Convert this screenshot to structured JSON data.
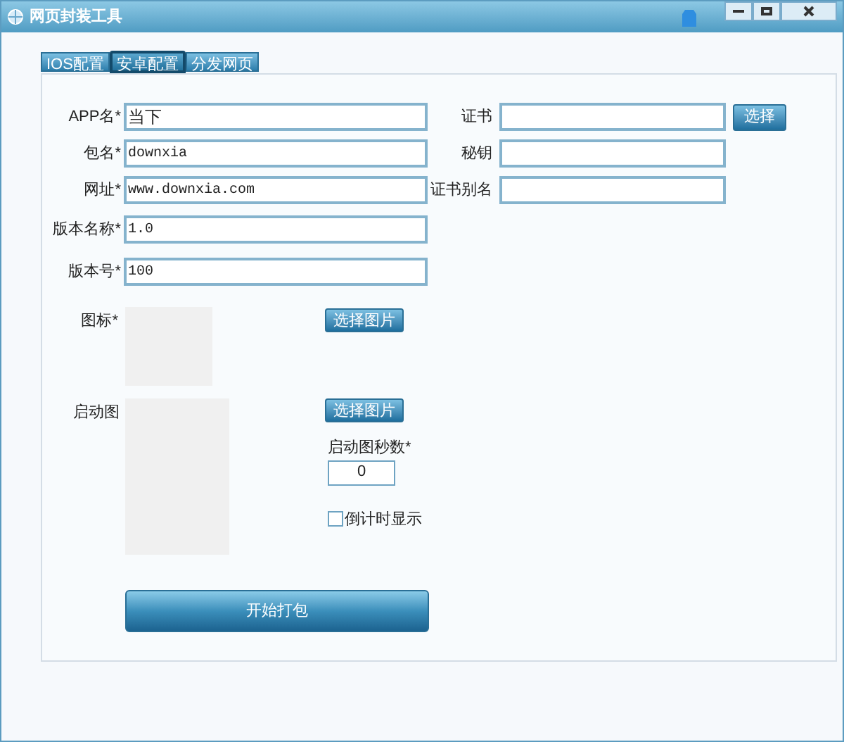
{
  "window": {
    "title": "网页封装工具"
  },
  "tabs": [
    {
      "label": "IOS配置",
      "selected": false
    },
    {
      "label": "安卓配置",
      "selected": true
    },
    {
      "label": "分发网页",
      "selected": false
    }
  ],
  "fields": [
    {
      "label": "APP名*",
      "value": "当下"
    },
    {
      "label": "包名*",
      "value": "downxia"
    },
    {
      "label": "网址*",
      "value": "www.downxia.com"
    },
    {
      "label": "版本名称*",
      "value": "1.0"
    },
    {
      "label": "版本号*",
      "value": "100"
    }
  ],
  "right_fields": [
    {
      "label": "证书"
    },
    {
      "label": "秘钥"
    },
    {
      "label": "证书别名"
    }
  ],
  "cert_button": "选择",
  "icon": {
    "label": "图标*",
    "button": "选择图片"
  },
  "splash": {
    "label": "启动图",
    "button": "选择图片",
    "seconds_label": "启动图秒数*",
    "seconds_value": "0",
    "countdown": {
      "label": "倒计时显示",
      "checked": false
    }
  },
  "start_button": "开始打包"
}
